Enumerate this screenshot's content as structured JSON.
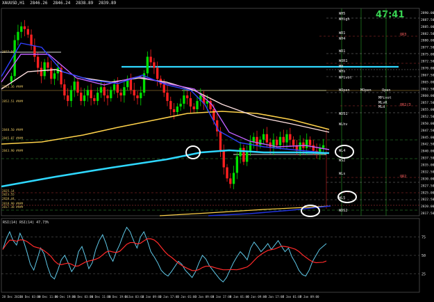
{
  "window": {
    "symbol": "XAUUSD,H1",
    "ohlc": [
      "2846.26",
      "2846.24",
      "2838.89",
      "2839.89"
    ],
    "countdown": "47:41"
  },
  "colors": {
    "background": "#000000",
    "bull": "#00e000",
    "bear": "#ff2020",
    "cyan_level": "#2fd8ff",
    "purple_ma": "#c060ff",
    "blue_ma": "#3040ff",
    "yellow_ma": "#ffd24a",
    "white_ma": "#ffe0e0",
    "rsi_line": "#5ec8e8",
    "rsi_signal": "#ff2a2a",
    "highlight_ring": "#ffffff"
  },
  "level_labels": [
    "WH5",
    "WHigh",
    "WR1",
    "WH4",
    "WR1",
    "WOR1",
    "MH",
    "WHs",
    "WPivot",
    "WOpen",
    "MOpen",
    "Open",
    "MPivot",
    "MLvR",
    "MLd",
    "WDS1",
    "WLhv",
    "WL4",
    "WS2",
    "WLs",
    "WL5",
    "WDS2"
  ],
  "right_labels": [
    "QR3",
    "QR2/3",
    "QR2"
  ],
  "left_labels": [
    "2877.56",
    "2853.36 ####",
    "2852.51 ####",
    "2848.50 ####",
    "2845.07 ####",
    "2843.90 ####",
    "2825.14",
    "2823.55",
    "2820.44",
    "2818.90 ####",
    "2817.38 ####"
  ],
  "price_axis": [
    "2890.00",
    "2887.50",
    "2885.00",
    "2882.50",
    "2880.00",
    "2877.50",
    "2875.00",
    "2872.50",
    "2870.00",
    "2867.50",
    "2865.00",
    "2862.50",
    "2860.00",
    "2857.50",
    "2855.00",
    "2852.50",
    "2850.00",
    "2847.50",
    "2845.00",
    "2842.50",
    "2840.00",
    "2837.50",
    "2835.00",
    "2832.50",
    "2830.00",
    "2827.50",
    "2825.00",
    "2822.50",
    "2820.00",
    "2817.50"
  ],
  "indicator": {
    "label": "RSI(14) RSI(14) 47.73%",
    "levels": [
      "75",
      "50",
      "25"
    ]
  },
  "time_axis": [
    "28 Dec 2024",
    "30 Dec 03:00",
    "30 Dec 11:00",
    "30 Dec 19:00",
    "31 Dec 03:00",
    "31 Dec 11:00",
    "31 Dec 19:00",
    "1 Jan 03:00",
    "2 Jan 09:00",
    "2 Jan 17:00",
    "3 Jan 01:00",
    "3 Jan 09:00",
    "3 Jan 17:00",
    "6 Jan 01:00",
    "6 Jan 09:00",
    "6 Jan 17:00",
    "7 Jan 01:00",
    "7 Jan 09:00"
  ]
}
